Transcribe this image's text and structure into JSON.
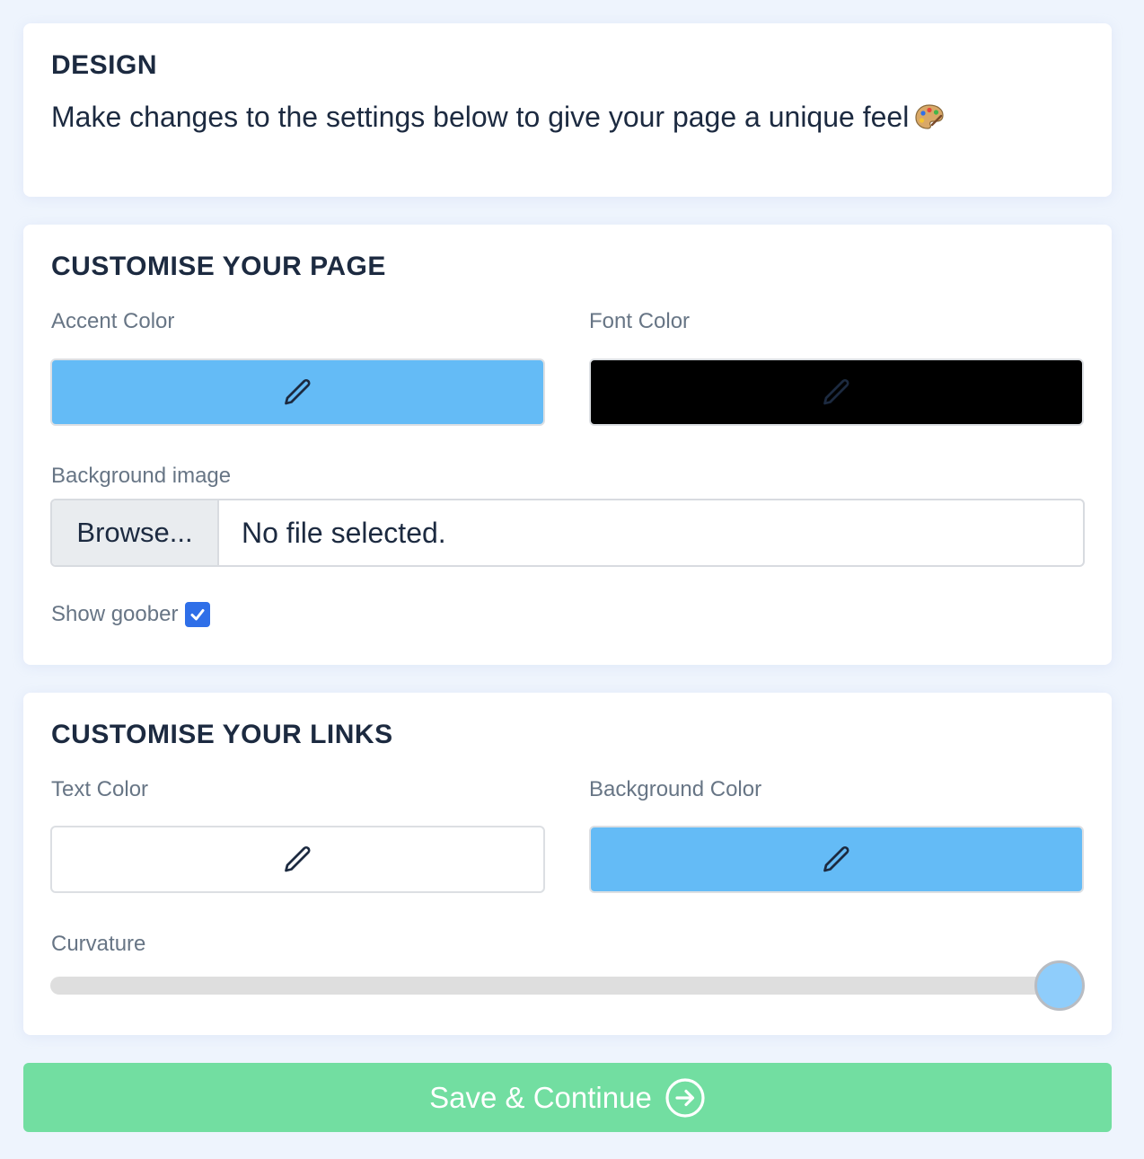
{
  "design": {
    "title": "DESIGN",
    "subtitle": "Make changes to the settings below to give your page a unique feel",
    "subtitle_icon": "palette-icon"
  },
  "page_section": {
    "title": "CUSTOMISE YOUR PAGE",
    "accent_color": {
      "label": "Accent Color",
      "value": "#64bbf6",
      "icon": "pencil-icon"
    },
    "font_color": {
      "label": "Font Color",
      "value": "#000000",
      "icon": "pencil-icon"
    },
    "background_image": {
      "label": "Background image",
      "browse_label": "Browse...",
      "status": "No file selected."
    },
    "show_goober": {
      "label": "Show goober",
      "checked": true
    }
  },
  "links_section": {
    "title": "CUSTOMISE YOUR LINKS",
    "text_color": {
      "label": "Text Color",
      "value": "#ffffff",
      "icon": "pencil-icon"
    },
    "background_color": {
      "label": "Background Color",
      "value": "#64bbf6",
      "icon": "pencil-icon"
    },
    "curvature": {
      "label": "Curvature",
      "value": 1.0
    }
  },
  "save_button": {
    "label": "Save & Continue",
    "icon": "arrow-right-circle-icon",
    "color": "#72dea1"
  }
}
